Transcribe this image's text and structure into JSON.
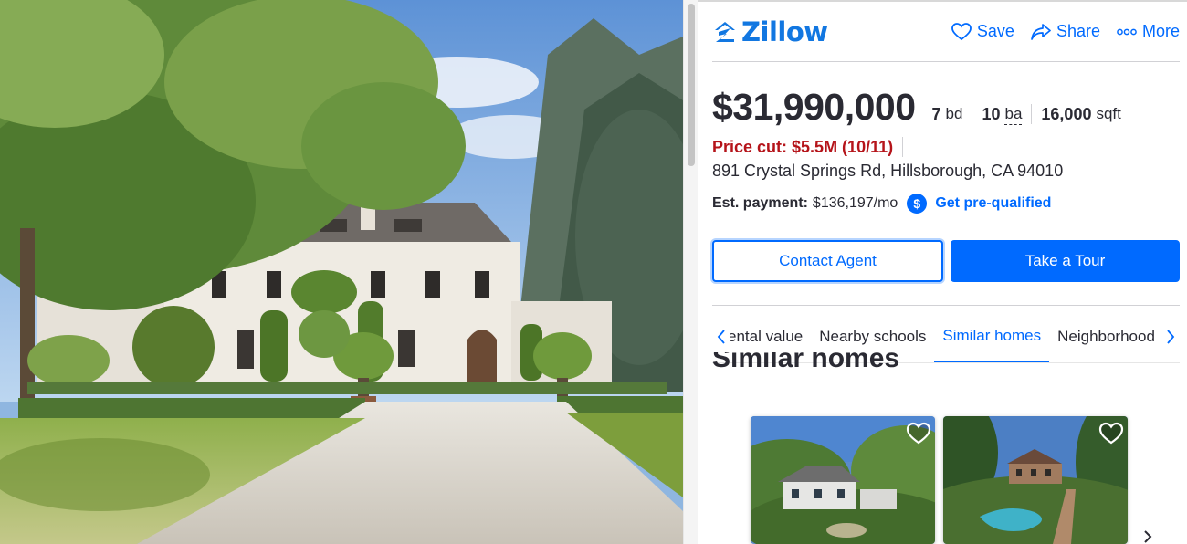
{
  "brand": {
    "name": "Zillow",
    "color": "#1277e1",
    "icon": "zillow-logo-icon"
  },
  "header": {
    "actions": [
      {
        "label": "Save",
        "icon": "heart-icon"
      },
      {
        "label": "Share",
        "icon": "share-arrow-icon"
      },
      {
        "label": "More",
        "icon": "more-dots-icon"
      }
    ]
  },
  "listing": {
    "price": "$31,990,000",
    "beds": {
      "value": "7",
      "unit": "bd"
    },
    "baths": {
      "value": "10",
      "unit": "ba"
    },
    "sqft": {
      "value": "16,000",
      "unit": "sqft"
    },
    "price_cut": "Price cut: $5.5M (10/11)",
    "address": "891 Crystal Springs Rd, Hillsborough, CA 94010",
    "payment_label": "Est. payment:",
    "payment_value": "$136,197/mo",
    "prequal_label": "Get pre-qualified"
  },
  "buttons": {
    "contact": "Contact Agent",
    "tour": "Take a Tour"
  },
  "tabs": {
    "items": [
      "ental value",
      "Nearby schools",
      "Similar homes",
      "Neighborhood"
    ],
    "active": "Similar homes"
  },
  "similar": {
    "heading": "Similar homes",
    "cards": [
      {
        "icon": "heart-outline-icon"
      },
      {
        "icon": "heart-outline-icon"
      }
    ]
  },
  "colors": {
    "accent": "#006aff",
    "price_cut": "#b5141a",
    "text": "#2a2a33"
  }
}
